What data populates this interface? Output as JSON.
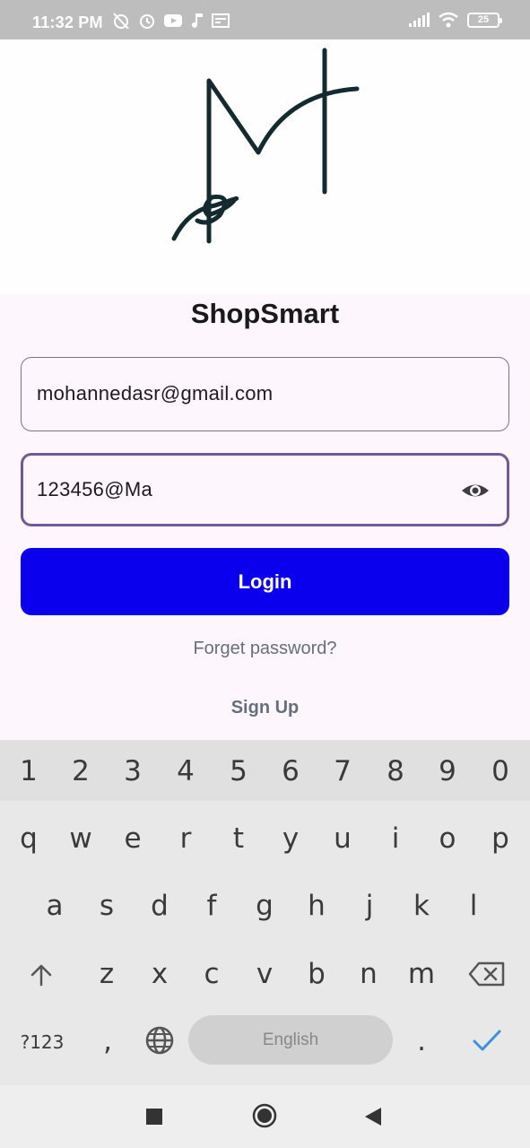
{
  "status_bar": {
    "time": "11:32 PM",
    "battery": "25",
    "icons": [
      "alarm-off-icon",
      "alarm-icon",
      "youtube-icon",
      "music-icon",
      "news-icon",
      "signal-icon",
      "wifi-icon",
      "battery-icon"
    ]
  },
  "app": {
    "title": "ShopSmart",
    "logo": "signature-logo"
  },
  "form": {
    "email_value": "mohannedasr@gmail.com",
    "password_value": "123456@Ma",
    "login_label": "Login",
    "forget_label": "Forget password?",
    "signup_label": "Sign Up"
  },
  "keyboard": {
    "numbers": [
      "1",
      "2",
      "3",
      "4",
      "5",
      "6",
      "7",
      "8",
      "9",
      "0"
    ],
    "row1": [
      "q",
      "w",
      "e",
      "r",
      "t",
      "y",
      "u",
      "i",
      "o",
      "p"
    ],
    "row2": [
      "a",
      "s",
      "d",
      "f",
      "g",
      "h",
      "j",
      "k",
      "l"
    ],
    "row3": [
      "z",
      "x",
      "c",
      "v",
      "b",
      "n",
      "m"
    ],
    "symbols_label": "?123",
    "comma": ",",
    "period": ".",
    "space_label": "English"
  },
  "colors": {
    "accent": "#0b00ee",
    "focus_border": "#6f5a93",
    "background": "#fdf6fd"
  }
}
